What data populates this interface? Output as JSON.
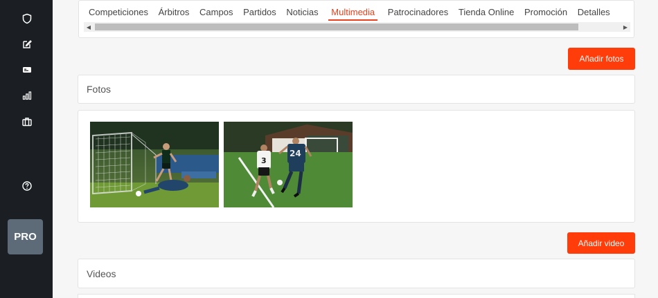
{
  "tabs": [
    {
      "label": "Competiciones"
    },
    {
      "label": "Árbitros"
    },
    {
      "label": "Campos"
    },
    {
      "label": "Partidos"
    },
    {
      "label": "Noticias"
    },
    {
      "label": "Multimedia",
      "active": true
    },
    {
      "label": "Patrocinadores"
    },
    {
      "label": "Tienda Online"
    },
    {
      "label": "Promoción"
    },
    {
      "label": "Detalles"
    }
  ],
  "sidebar": {
    "icons": [
      "shield-icon",
      "edit-icon",
      "id-card-icon",
      "bar-chart-icon",
      "briefcase-icon",
      "help-icon"
    ],
    "badge": "PRO"
  },
  "actions": {
    "add_photos": "Añadir fotos",
    "add_video": "Añadir video"
  },
  "sections": {
    "photos_title": "Fotos",
    "videos_title": "Videos"
  },
  "photos": [
    {
      "alt": "football-goal-save-photo",
      "player_number": ""
    },
    {
      "alt": "football-players-running-photo",
      "player_number": "24"
    }
  ],
  "colors": {
    "accent": "#fe3d0b",
    "active_tab": "#e8411c",
    "sidebar_bg": "#1b1f24",
    "badge_bg": "#5d6b78"
  }
}
